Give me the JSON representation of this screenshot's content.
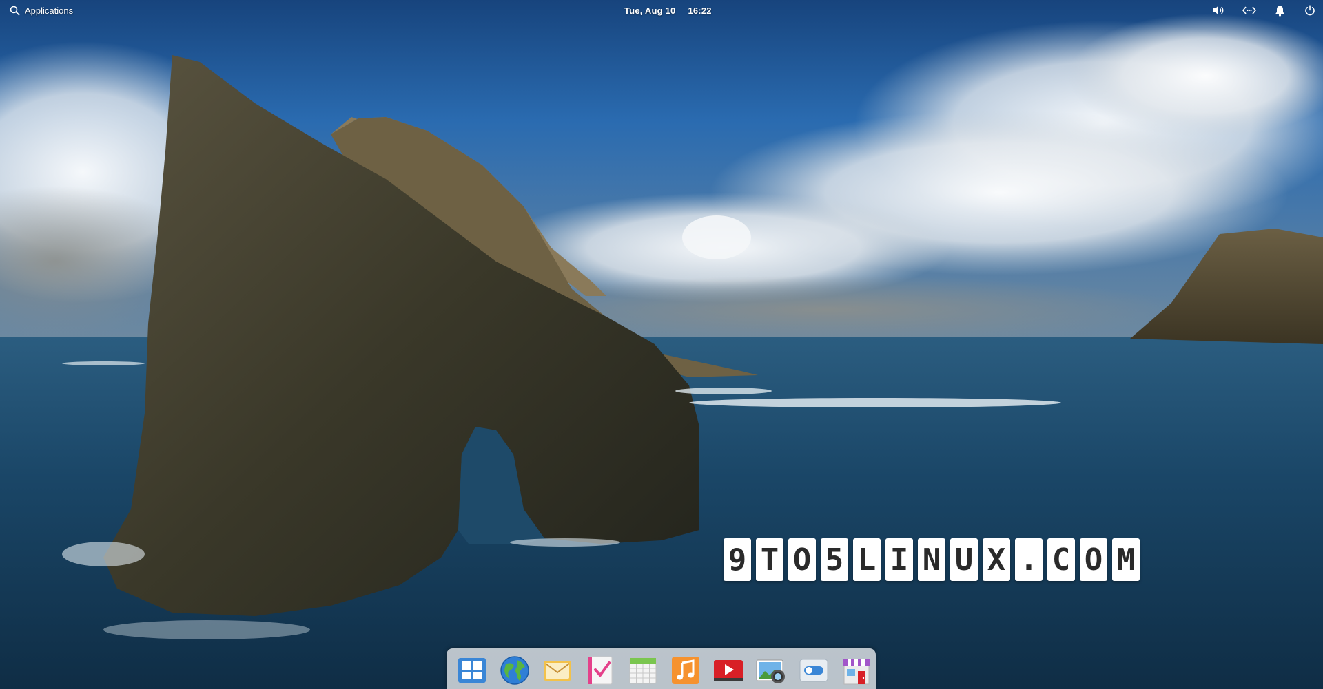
{
  "panel": {
    "applications_label": "Applications",
    "date": "Tue, Aug 10",
    "time": "16:22",
    "indicators": [
      "volume-icon",
      "network-icon",
      "notifications-icon",
      "power-icon"
    ]
  },
  "watermark": {
    "chars": [
      "9",
      "T",
      "O",
      "5",
      "L",
      "I",
      "N",
      "U",
      "X",
      ".",
      "C",
      "O",
      "M"
    ]
  },
  "dock": {
    "apps": [
      {
        "name": "Multitasking View",
        "icon": "multitasking-icon"
      },
      {
        "name": "Web",
        "icon": "web-browser-icon"
      },
      {
        "name": "Mail",
        "icon": "mail-icon"
      },
      {
        "name": "Tasks",
        "icon": "tasks-icon"
      },
      {
        "name": "Calendar",
        "icon": "calendar-icon"
      },
      {
        "name": "Music",
        "icon": "music-icon"
      },
      {
        "name": "Videos",
        "icon": "videos-icon"
      },
      {
        "name": "Photos",
        "icon": "photos-icon"
      },
      {
        "name": "System Settings",
        "icon": "settings-icon"
      },
      {
        "name": "AppCenter",
        "icon": "appcenter-icon"
      }
    ]
  },
  "colors": {
    "sky_top": "#1a4f8c",
    "sea": "#143a58",
    "rock": "#3d3a2a",
    "panel_text": "#ffffff"
  }
}
